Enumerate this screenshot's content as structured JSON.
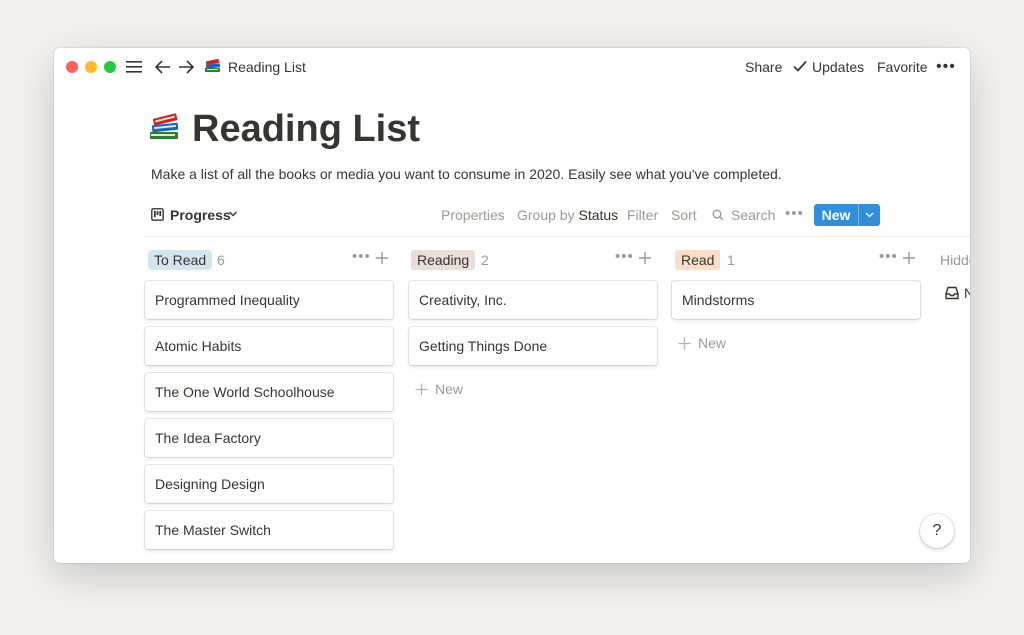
{
  "titlebar": {
    "breadcrumb": "Reading List",
    "share": "Share",
    "updates": "Updates",
    "favorite": "Favorite",
    "more": "•••"
  },
  "page": {
    "title": "Reading List",
    "description": "Make a list of all the books or media you want to consume in 2020. Easily see what you've completed."
  },
  "toolbar": {
    "view_name": "Progress",
    "properties": "Properties",
    "group_by": "Group by",
    "group_by_value": "Status",
    "filter": "Filter",
    "sort": "Sort",
    "search": "Search",
    "more": "•••",
    "new": "New"
  },
  "board": {
    "columns": [
      {
        "label": "To Read",
        "count": "6",
        "color": "#d3e5ef",
        "cards": [
          "Programmed Inequality",
          "Atomic Habits",
          "The One World Schoolhouse",
          "The Idea Factory",
          "Designing Design",
          "The Master Switch"
        ]
      },
      {
        "label": "Reading",
        "count": "2",
        "color": "#e8deda",
        "cards": [
          "Creativity, Inc.",
          "Getting Things Done"
        ],
        "new": "New"
      },
      {
        "label": "Read",
        "count": "1",
        "color": "#fadec9",
        "cards": [
          "Mindstorms"
        ],
        "new": "New"
      }
    ],
    "hidden_label": "Hidde",
    "hidden_item": "N",
    "dots": "•••"
  },
  "help": "?"
}
